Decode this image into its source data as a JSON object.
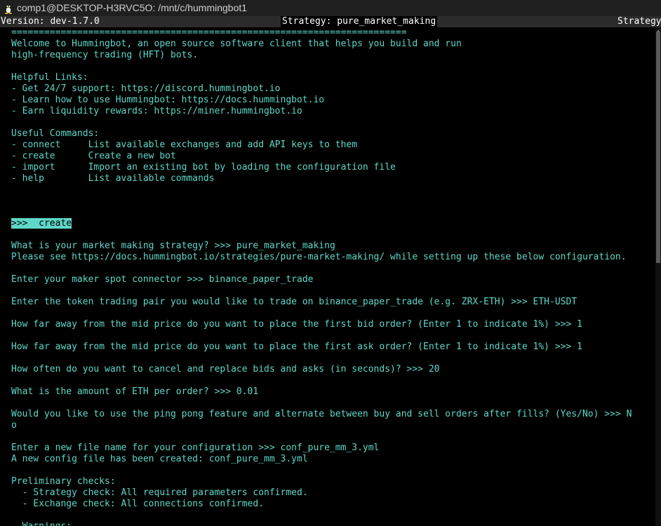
{
  "window": {
    "title": "comp1@DESKTOP-H3RVC5O: /mnt/c/hummingbot1"
  },
  "status_bar": {
    "version": "Version: dev-1.7.0",
    "strategy": "Strategy: pure_market_making",
    "strategy_truncated": "Strategy"
  },
  "terminal": {
    "lines": [
      "========================================================================",
      "Welcome to Hummingbot, an open source software client that helps you build and run",
      "high-frequency trading (HFT) bots.",
      "",
      "Helpful Links:",
      "- Get 24/7 support: https://discord.hummingbot.io",
      "- Learn how to use Hummingbot: https://docs.hummingbot.io",
      "- Earn liquidity rewards: https://miner.hummingbot.io",
      "",
      "Useful Commands:",
      "- connect     List available exchanges and add API keys to them",
      "- create      Create a new bot",
      "- import      Import an existing bot by loading the configuration file",
      "- help        List available commands",
      "",
      "",
      "",
      ">>>  create",
      "",
      "What is your market making strategy? >>> pure_market_making",
      "Please see https://docs.hummingbot.io/strategies/pure-market-making/ while setting up these below configuration.",
      "",
      "Enter your maker spot connector >>> binance_paper_trade",
      "",
      "Enter the token trading pair you would like to trade on binance_paper_trade (e.g. ZRX-ETH) >>> ETH-USDT",
      "",
      "How far away from the mid price do you want to place the first bid order? (Enter 1 to indicate 1%) >>> 1",
      "",
      "How far away from the mid price do you want to place the first ask order? (Enter 1 to indicate 1%) >>> 1",
      "",
      "How often do you want to cancel and replace bids and asks (in seconds)? >>> 20",
      "",
      "What is the amount of ETH per order? >>> 0.01",
      "",
      "Would you like to use the ping pong feature and alternate between buy and sell orders after fills? (Yes/No) >>> N",
      "o",
      "",
      "Enter a new file name for your configuration >>> conf_pure_mm_3.yml",
      "A new config file has been created: conf_pure_mm_3.yml",
      "",
      "Preliminary checks:",
      "  - Strategy check: All required parameters confirmed.",
      "  - Exchange check: All connections confirmed.",
      "",
      "  Warnings:"
    ],
    "highlighted_line_index": 17
  },
  "colors": {
    "text": "#5fd7c8",
    "background": "#000000",
    "titlebar": "#1f1f1f",
    "statusbar": "#2b2b2b"
  },
  "icons": {
    "window_icon": "tux-linux-icon",
    "scroll_up": "scroll-up-arrow-icon"
  }
}
